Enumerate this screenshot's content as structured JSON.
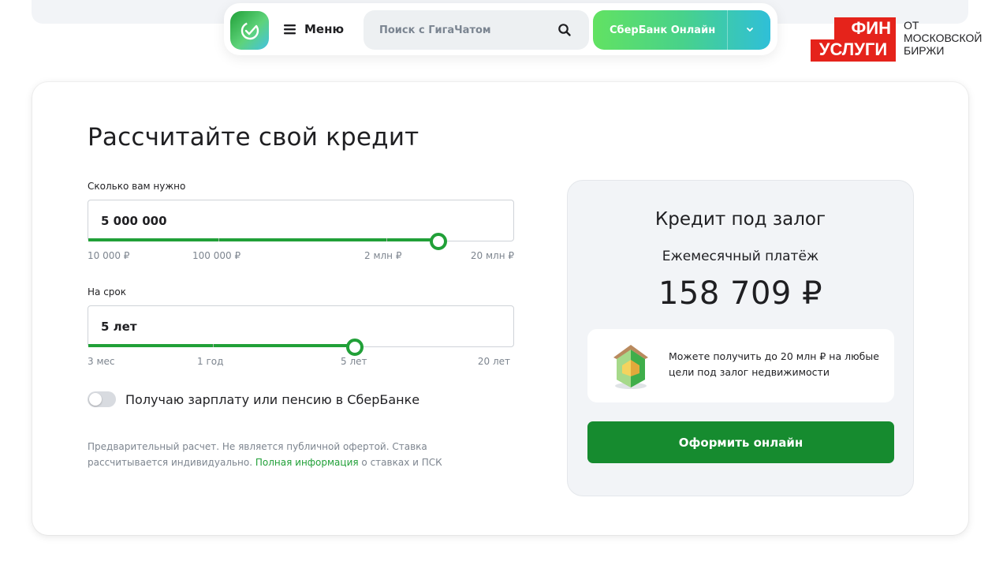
{
  "header": {
    "menu_label": "Меню",
    "search_placeholder": "Поиск с ГигаЧатом",
    "sber_online_label": "СберБанк Онлайн"
  },
  "finuslugi": {
    "line1": "ФИН",
    "line2": "УСЛУГИ",
    "tagline1": "ОТ",
    "tagline2": "МОСКОВСКОЙ",
    "tagline3": "БИРЖИ"
  },
  "calculator": {
    "title": "Рассчитайте свой кредит",
    "amount": {
      "label": "Сколько вам нужно",
      "value": "5 000 000",
      "slider_fraction": 0.82,
      "scale": [
        "10 000 ₽",
        "100 000 ₽",
        "2 млн ₽",
        "20 млн ₽"
      ]
    },
    "term": {
      "label": "На срок",
      "value": "5 лет",
      "slider_fraction": 0.625,
      "scale": [
        "3 мес",
        "1 год",
        "5 лет",
        "20 лет"
      ]
    },
    "salary_toggle": {
      "label": "Получаю зарплату или пенсию в СберБанке",
      "on": false
    },
    "disclaimer_before": "Предварительный расчет. Не является публичной офертой. Ставка рассчитывается индивидуально. ",
    "disclaimer_link": "Полная информация",
    "disclaimer_after": " о ставках и ПСК"
  },
  "result": {
    "title": "Кредит под залог",
    "subtitle": "Ежемесячный платёж",
    "amount": "158 709 ₽",
    "promo_text": "Можете получить до 20 млн ₽ на любые цели под залог недвижимости",
    "cta_label": "Оформить онлайн"
  },
  "colors": {
    "accent": "#21a038",
    "cta": "#168b2f",
    "brand_red": "#e5231b"
  },
  "icons": [
    "sber-logo-icon",
    "menu-icon",
    "search-icon",
    "chevron-down-icon",
    "house-3d-icon"
  ]
}
